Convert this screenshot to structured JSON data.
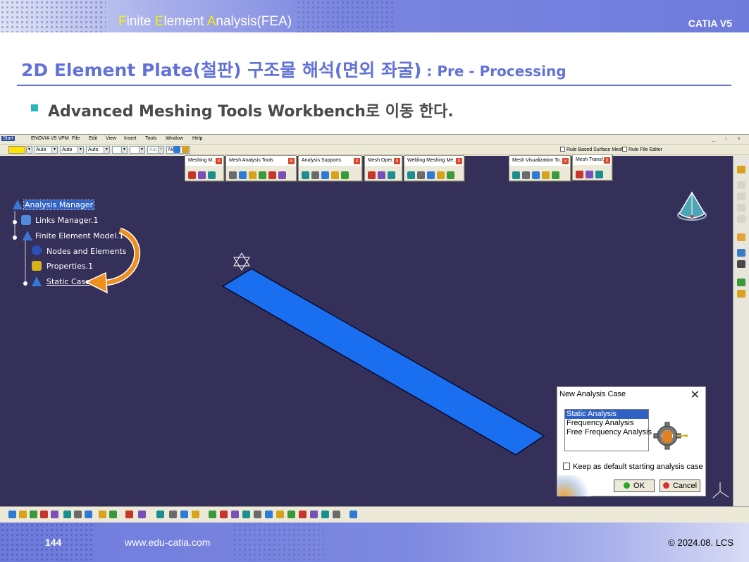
{
  "header": {
    "title_parts": [
      {
        "text": "F",
        "hl": true
      },
      {
        "text": "inite ",
        "hl": false
      },
      {
        "text": "E",
        "hl": true
      },
      {
        "text": "lement ",
        "hl": false
      },
      {
        "text": "A",
        "hl": true
      },
      {
        "text": "nalysis(FEA)",
        "hl": false
      }
    ],
    "brand": "CATIA V5"
  },
  "slide": {
    "title_main": "2D Element Plate(철판) 구조물 해석(면외 좌굴)",
    "title_suffix": " : Pre - Processing",
    "subtitle": "Advanced Meshing Tools Workbench로 이동 한다."
  },
  "catia": {
    "menu": [
      "Start",
      "ENOVIA V5 VPM",
      "File",
      "Edit",
      "View",
      "Insert",
      "Tools",
      "Window",
      "Help"
    ],
    "toolbar_combos": [
      "Auto",
      "Auto",
      "Auto",
      "",
      "",
      "Aut",
      "None"
    ],
    "checkboxes": [
      "Rule Based Surface Mesh",
      "Rule File Editor"
    ],
    "floating_toolbars": [
      {
        "title": "Meshing M...",
        "icons": 3
      },
      {
        "title": "Mesh Analysis Tools",
        "icons": 6
      },
      {
        "title": "Analysis Supports",
        "icons": 5
      },
      {
        "title": "Mesh Oper...",
        "icons": 3
      },
      {
        "title": "Welding Meshing Me...",
        "icons": 5
      },
      {
        "title": "Mesh Visualization To...",
        "icons": 5
      },
      {
        "title": "Mesh Transf...",
        "icons": 3
      }
    ],
    "tree": {
      "root": "Analysis Manager",
      "links": "Links Manager.1",
      "model": "Finite Element Model.1",
      "nodes": "Nodes and Elements",
      "props": "Properties.1",
      "case": "Static Case"
    },
    "icon_colors": [
      "#2e7bd6",
      "#d9a21b",
      "#3a9a3a",
      "#c8362b",
      "#7a4fb8",
      "#1b8f8f",
      "#6b6b6b"
    ]
  },
  "dialog": {
    "title": "New Analysis Case",
    "close": "✕",
    "options": [
      "Static Analysis",
      "Frequency Analysis",
      "Free Frequency Analysis"
    ],
    "selected": 0,
    "checkbox_label": "Keep as default starting analysis case",
    "ok": "OK",
    "cancel": "Cancel"
  },
  "footer": {
    "page": "144",
    "url": "www.edu-catia.com",
    "copyright": "© 2024.08. LCS"
  },
  "colors": {
    "accent": "#6272d8",
    "viewport": "#353059",
    "plate": "#1a6ff0",
    "arrow": "#ee8e1e"
  }
}
